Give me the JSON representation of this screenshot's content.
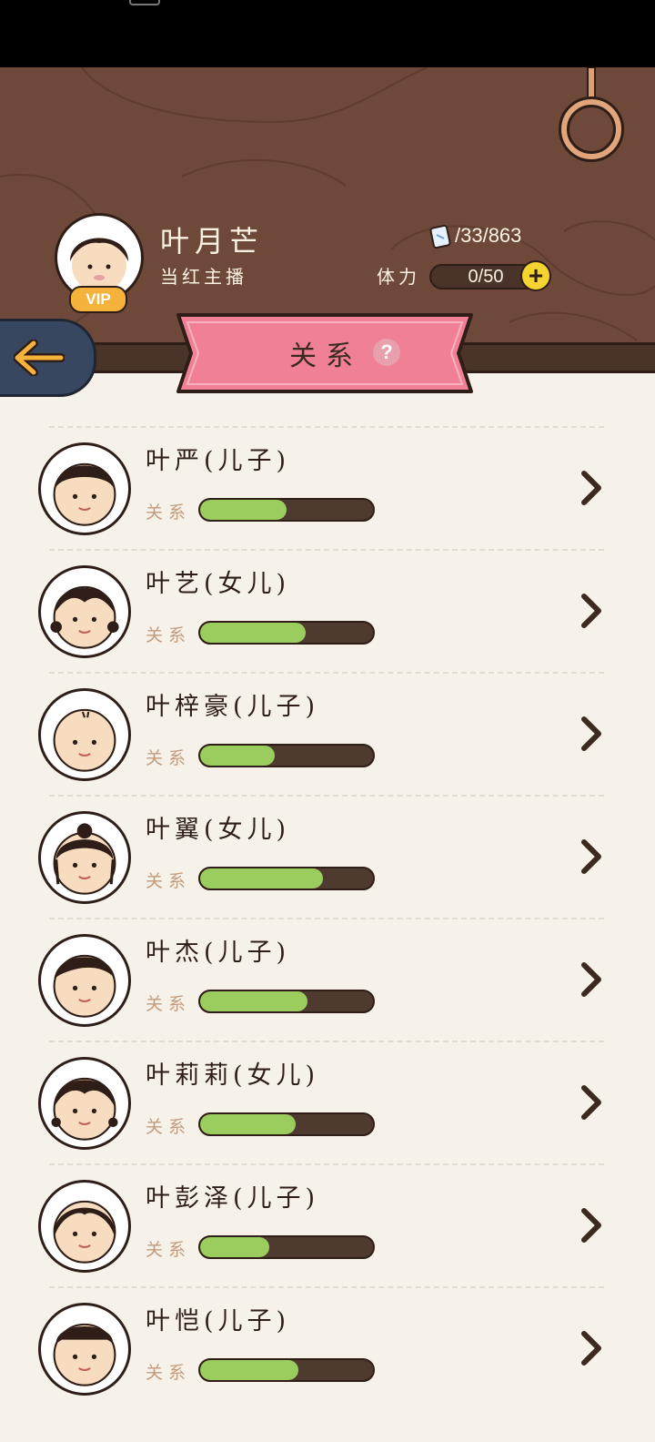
{
  "player": {
    "name": "叶月芒",
    "title": "当红主播",
    "vip": "VIP",
    "tickets": "/33/863",
    "stamina_label": "体力",
    "stamina": "0/50",
    "stamina_add": "+"
  },
  "page": {
    "title": "关系",
    "help": "?"
  },
  "relation_label": "关系",
  "children": [
    {
      "name": "叶严(儿子)",
      "relation": 0.5
    },
    {
      "name": "叶艺(女儿)",
      "relation": 0.61
    },
    {
      "name": "叶梓豪(儿子)",
      "relation": 0.43
    },
    {
      "name": "叶翼(女儿)",
      "relation": 0.71
    },
    {
      "name": "叶杰(儿子)",
      "relation": 0.62
    },
    {
      "name": "叶莉莉(女儿)",
      "relation": 0.55
    },
    {
      "name": "叶彭泽(儿子)",
      "relation": 0.4
    },
    {
      "name": "叶恺(儿子)",
      "relation": 0.57
    }
  ],
  "colors": {
    "wood": "#6e4838",
    "ribbon": "#f08095",
    "bar_fill": "#9acd5e",
    "back_button": "#37475f",
    "vip": "#f5b33c"
  }
}
